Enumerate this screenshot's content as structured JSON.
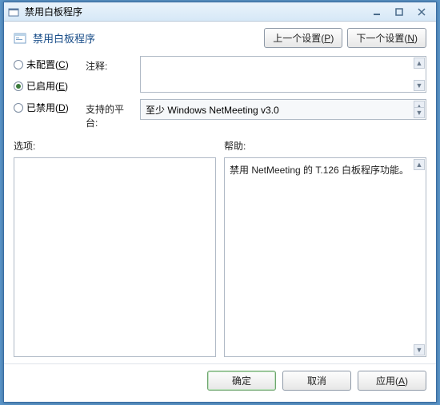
{
  "window": {
    "title": "禁用白板程序"
  },
  "header": {
    "title": "禁用白板程序"
  },
  "nav": {
    "prev": {
      "text": "上一个设置",
      "accel": "P"
    },
    "next": {
      "text": "下一个设置",
      "accel": "N"
    }
  },
  "radios": {
    "unconfigured": {
      "text": "未配置",
      "accel": "C",
      "selected": false
    },
    "enabled": {
      "text": "已启用",
      "accel": "E",
      "selected": true
    },
    "disabled": {
      "text": "已禁用",
      "accel": "D",
      "selected": false
    }
  },
  "fields": {
    "comment_label": "注释:",
    "comment_value": "",
    "platform_label": "支持的平台:",
    "platform_value": "至少 Windows NetMeeting v3.0"
  },
  "panes": {
    "options_label": "选项:",
    "help_label": "帮助:",
    "help_text": "禁用 NetMeeting 的 T.126 白板程序功能。"
  },
  "footer": {
    "ok": "确定",
    "cancel": "取消",
    "apply": {
      "text": "应用",
      "accel": "A"
    }
  }
}
